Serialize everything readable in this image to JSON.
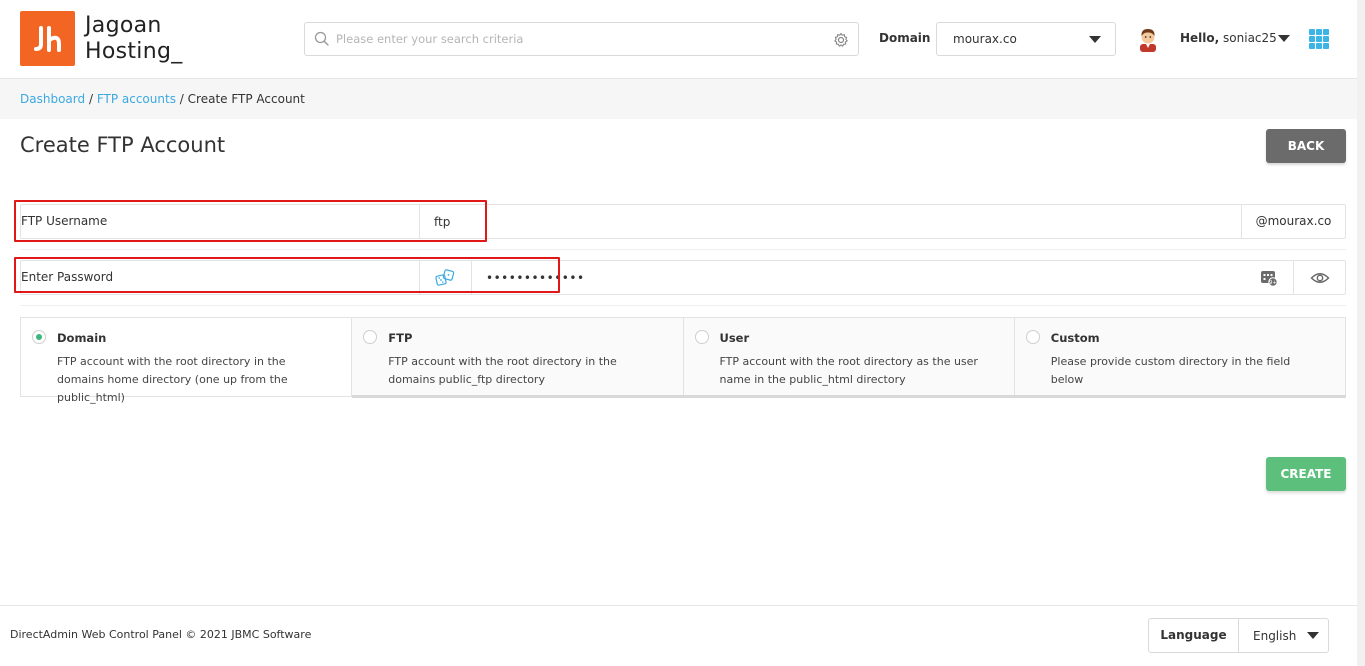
{
  "header": {
    "logo": {
      "line1": "Jagoan",
      "line2": "Hosting_",
      "brand_color": "#f26522"
    },
    "search": {
      "placeholder": "Please enter your search criteria",
      "value": ""
    },
    "domain_label": "Domain",
    "domain_value": "mourax.co",
    "greeting": "Hello,",
    "username": "soniac25"
  },
  "breadcrumb": {
    "items": [
      "Dashboard",
      "FTP accounts"
    ],
    "separator": "/",
    "current": "Create FTP Account"
  },
  "page": {
    "title": "Create FTP Account",
    "back_label": "BACK",
    "create_label": "CREATE"
  },
  "form": {
    "username": {
      "label": "FTP Username",
      "value": "ftp",
      "suffix": "@mourax.co"
    },
    "password": {
      "label": "Enter Password",
      "value": "•••••••••••••"
    }
  },
  "options": [
    {
      "title": "Domain",
      "desc": "FTP account with the root directory in the domains home directory (one up from the public_html)",
      "selected": true
    },
    {
      "title": "FTP",
      "desc": "FTP account with the root directory in the domains public_ftp directory",
      "selected": false
    },
    {
      "title": "User",
      "desc": "FTP account with the root directory as the user name in the public_html directory",
      "selected": false
    },
    {
      "title": "Custom",
      "desc": "Please provide custom directory in the field below",
      "selected": false
    }
  ],
  "footer": {
    "copyright": "DirectAdmin Web Control Panel © 2021 JBMC Software",
    "language_label": "Language",
    "language_value": "English"
  },
  "colors": {
    "accent": "#3ba9e0",
    "success": "#5cc07c",
    "highlight": "#e01818"
  }
}
